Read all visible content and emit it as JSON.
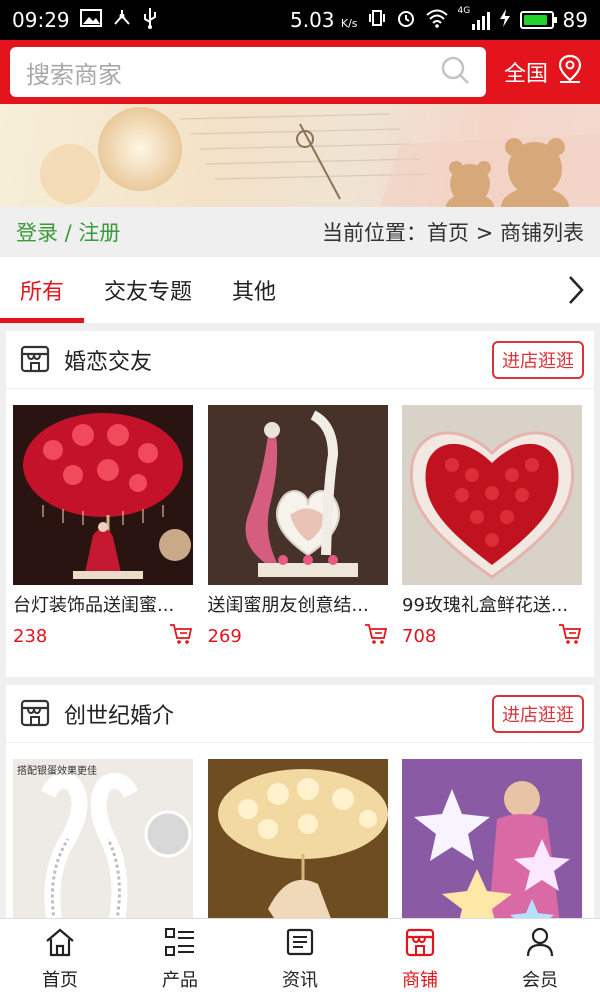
{
  "status_bar": {
    "time": "09:29",
    "speed": "5.03",
    "speed_unit": "K/s",
    "battery": "89",
    "network": "4G"
  },
  "header": {
    "search_placeholder": "搜索商家",
    "region": "全国"
  },
  "crumb": {
    "login": "登录 / 注册",
    "location": "当前位置：首页 > 商铺列表"
  },
  "tabs": [
    {
      "label": "所有"
    },
    {
      "label": "交友专题"
    },
    {
      "label": "其他"
    }
  ],
  "stores": [
    {
      "name": "婚恋交友",
      "visit": "进店逛逛",
      "products": [
        {
          "title": "台灯装饰品送闺蜜...",
          "price": "238"
        },
        {
          "title": "送闺蜜朋友创意结...",
          "price": "269"
        },
        {
          "title": "99玫瑰礼盒鲜花送...",
          "price": "708"
        }
      ]
    },
    {
      "name": "创世纪婚介",
      "visit": "进店逛逛",
      "image_caption": "搭配银蛋效果更佳"
    }
  ],
  "bottom_nav": [
    {
      "label": "首页"
    },
    {
      "label": "产品"
    },
    {
      "label": "资讯"
    },
    {
      "label": "商铺"
    },
    {
      "label": "会员"
    }
  ],
  "colors": {
    "brand_red": "#e3141b",
    "login_green": "#3a9a3a"
  }
}
